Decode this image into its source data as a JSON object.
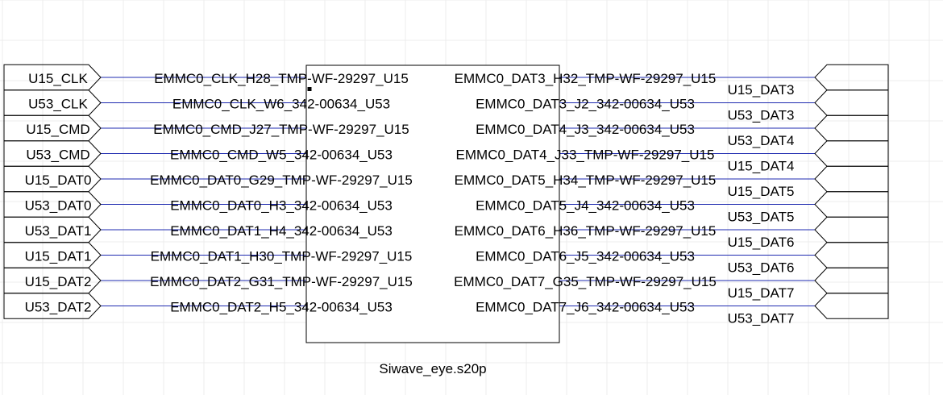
{
  "component": {
    "name": "Siwave_eye.s20p"
  },
  "left_ports": [
    "U15_CLK",
    "U53_CLK",
    "U15_CMD",
    "U53_CMD",
    "U15_DAT0",
    "U53_DAT0",
    "U53_DAT1",
    "U15_DAT1",
    "U15_DAT2",
    "U53_DAT2"
  ],
  "left_pins": [
    "EMMC0_CLK_H28_TMP-WF-29297_U15",
    "EMMC0_CLK_W6_342-00634_U53",
    "EMMC0_CMD_J27_TMP-WF-29297_U15",
    "EMMC0_CMD_W5_342-00634_U53",
    "EMMC0_DAT0_G29_TMP-WF-29297_U15",
    "EMMC0_DAT0_H3_342-00634_U53",
    "EMMC0_DAT1_H4_342-00634_U53",
    "EMMC0_DAT1_H30_TMP-WF-29297_U15",
    "EMMC0_DAT2_G31_TMP-WF-29297_U15",
    "EMMC0_DAT2_H5_342-00634_U53"
  ],
  "right_pins": [
    "EMMC0_DAT3_H32_TMP-WF-29297_U15",
    "EMMC0_DAT3_J2_342-00634_U53",
    "EMMC0_DAT4_J3_342-00634_U53",
    "EMMC0_DAT4_J33_TMP-WF-29297_U15",
    "EMMC0_DAT5_H34_TMP-WF-29297_U15",
    "EMMC0_DAT5_J4_342-00634_U53",
    "EMMC0_DAT6_H36_TMP-WF-29297_U15",
    "EMMC0_DAT6_J5_342-00634_U53",
    "EMMC0_DAT7_G35_TMP-WF-29297_U15",
    "EMMC0_DAT7_J6_342-00634_U53"
  ],
  "right_ports": [
    "U15_DAT3",
    "U53_DAT3",
    "U53_DAT4",
    "U15_DAT4",
    "U15_DAT5",
    "U53_DAT5",
    "U15_DAT6",
    "U53_DAT6",
    "U15_DAT7",
    "U53_DAT7"
  ],
  "colors": {
    "wire": "#1f2bb0",
    "outline": "#000000",
    "grid": "#ececec"
  }
}
